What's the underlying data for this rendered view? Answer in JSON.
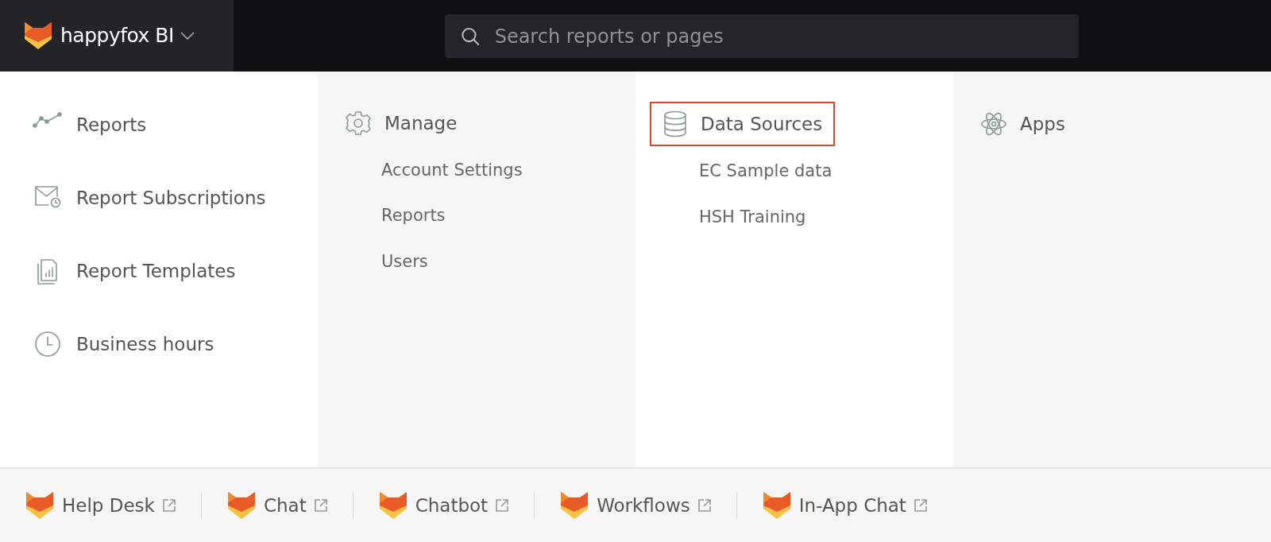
{
  "header": {
    "brand": "happyfox",
    "product": "BI",
    "search": {
      "placeholder": "Search reports or pages"
    }
  },
  "nav_items": [
    {
      "label": "Reports",
      "kind": "trend"
    },
    {
      "label": "Report Subscriptions",
      "kind": "mail"
    },
    {
      "label": "Report Templates",
      "kind": "templates"
    },
    {
      "label": "Business hours",
      "kind": "clock"
    }
  ],
  "menu_columns": [
    {
      "title": "Manage",
      "kind": "gear",
      "highlighted": false,
      "items": [
        "Account Settings",
        "Reports",
        "Users"
      ]
    },
    {
      "title": "Data Sources",
      "kind": "database",
      "highlighted": true,
      "items": [
        "EC Sample data",
        "HSH Training"
      ]
    },
    {
      "title": "Apps",
      "kind": "atom",
      "highlighted": false
    }
  ],
  "footer_links": [
    {
      "label": "Help Desk"
    },
    {
      "label": "Chat"
    },
    {
      "label": "Chatbot"
    },
    {
      "label": "Workflows"
    },
    {
      "label": "In-App Chat"
    }
  ]
}
